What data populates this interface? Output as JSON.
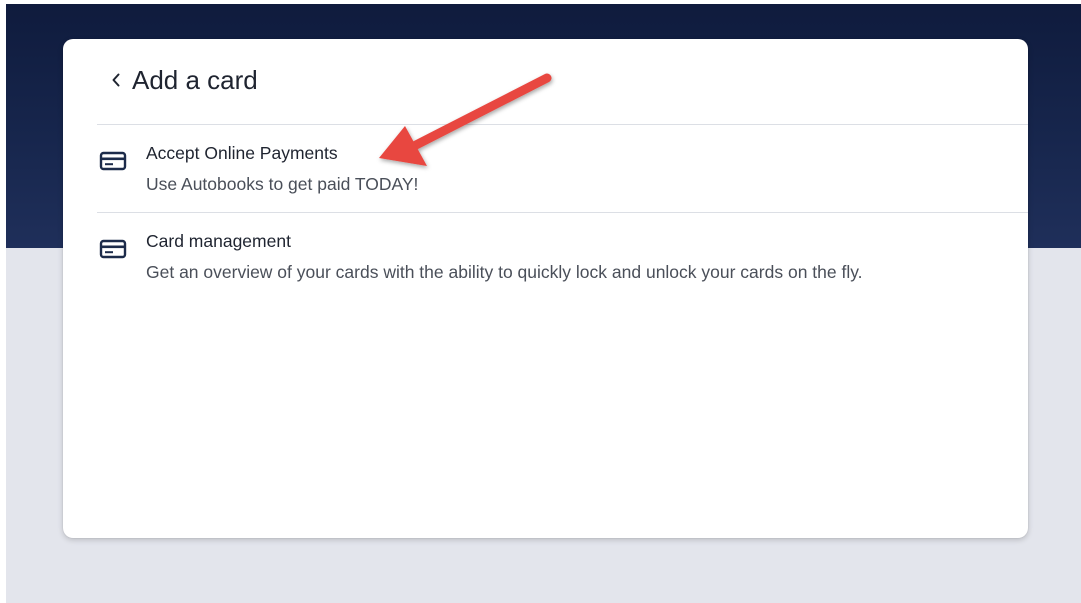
{
  "panel": {
    "title": "Add a card",
    "back_icon": "chevron-left-icon"
  },
  "items": [
    {
      "title": "Accept Online Payments",
      "description": "Use Autobooks to get paid TODAY!",
      "icon": "credit-card-icon"
    },
    {
      "title": "Card management",
      "description": "Get an overview of your cards with the ability to quickly lock and unlock your cards on the fly.",
      "icon": "credit-card-icon"
    }
  ],
  "colors": {
    "hero_background": "#0f1b3d",
    "page_background": "#e3e5ec",
    "panel_background": "#ffffff",
    "annotation_arrow": "#e8463f",
    "icon_color": "#1c2b4a"
  }
}
